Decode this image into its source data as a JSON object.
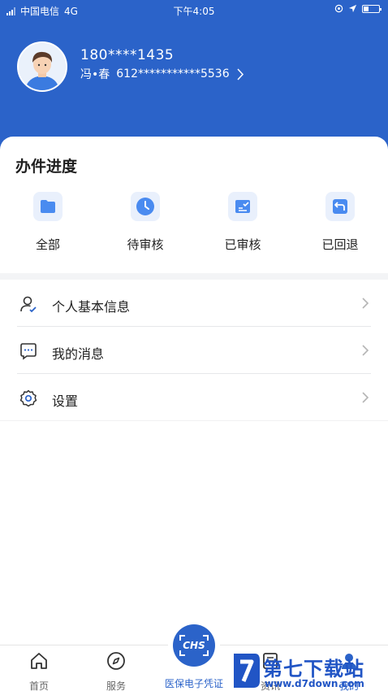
{
  "status_bar": {
    "carrier": "中国电信",
    "network": "4G",
    "time": "下午4:05"
  },
  "profile": {
    "phone": "180****1435",
    "name": "冯•春",
    "id_number": "612***********5536"
  },
  "progress": {
    "title": "办件进度",
    "items": [
      {
        "label": "全部",
        "icon": "folder-icon"
      },
      {
        "label": "待审核",
        "icon": "clock-icon"
      },
      {
        "label": "已审核",
        "icon": "reviewed-doc-icon"
      },
      {
        "label": "已回退",
        "icon": "return-arrow-icon"
      }
    ]
  },
  "menu": {
    "items": [
      {
        "label": "个人基本信息",
        "icon": "user-check-icon"
      },
      {
        "label": "我的消息",
        "icon": "message-icon"
      },
      {
        "label": "设置",
        "icon": "gear-icon"
      }
    ]
  },
  "tabbar": {
    "items": [
      {
        "label": "首页",
        "icon": "home-icon"
      },
      {
        "label": "服务",
        "icon": "compass-icon"
      },
      {
        "label": "医保电子凭证",
        "icon": "chs-scan-icon",
        "badge": "CHS"
      },
      {
        "label": "资讯",
        "icon": "news-icon"
      },
      {
        "label": "我的",
        "icon": "user-icon"
      }
    ]
  },
  "watermark": {
    "main": "第七下载站",
    "sub": "www.d7down.com"
  },
  "colors": {
    "primary": "#2b63c9",
    "icon_bg": "#e9f0fc",
    "icon_fg": "#4a8bf0"
  }
}
